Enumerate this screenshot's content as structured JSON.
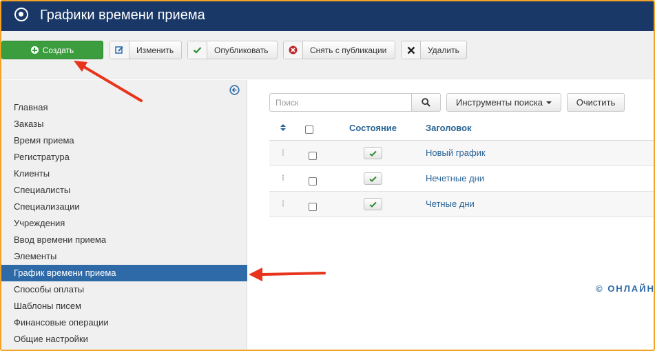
{
  "header": {
    "title": "Графики времени приема",
    "logo_icon": "joomla-logo-icon"
  },
  "toolbar": {
    "create_label": "Создать",
    "edit_label": "Изменить",
    "publish_label": "Опубликовать",
    "unpublish_label": "Снять с публикации",
    "delete_label": "Удалить",
    "colors": {
      "create": "#3c9d3e",
      "publish_check": "#2e8b2f",
      "unpublish": "#c0282d"
    }
  },
  "sidebar": {
    "items": [
      {
        "label": "Главная"
      },
      {
        "label": "Заказы"
      },
      {
        "label": "Время приема"
      },
      {
        "label": "Регистратура"
      },
      {
        "label": "Клиенты"
      },
      {
        "label": "Специалисты"
      },
      {
        "label": "Специализации"
      },
      {
        "label": "Учреждения"
      },
      {
        "label": "Ввод времени приема"
      },
      {
        "label": "Элементы"
      },
      {
        "label": "График времени приема",
        "active": true
      },
      {
        "label": "Способы оплаты"
      },
      {
        "label": "Шаблоны писем"
      },
      {
        "label": "Финансовые операции"
      },
      {
        "label": "Общие настройки"
      }
    ]
  },
  "search": {
    "placeholder": "Поиск",
    "value": "",
    "tools_label": "Инструменты поиска",
    "clear_label": "Очистить"
  },
  "table": {
    "columns": {
      "state": "Состояние",
      "title": "Заголовок"
    },
    "rows": [
      {
        "title": "Новый график",
        "published": true
      },
      {
        "title": "Нечетные дни",
        "published": true
      },
      {
        "title": "Четные дни",
        "published": true
      }
    ]
  },
  "footer": {
    "text": "© ОНЛАЙН"
  },
  "accent_colors": {
    "header": "#1a3867",
    "active": "#2e6aa8",
    "link": "#2a6496",
    "annotation": "#e8341c"
  }
}
